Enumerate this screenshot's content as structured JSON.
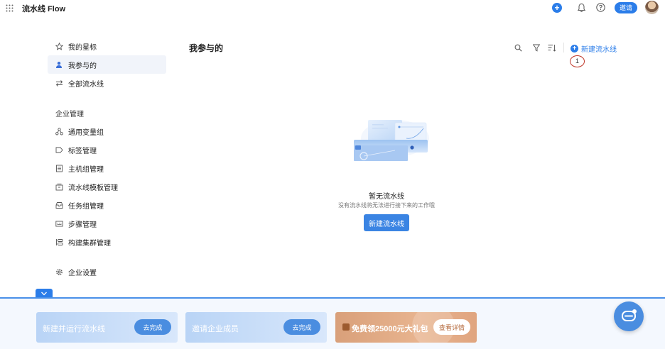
{
  "header": {
    "app_title": "流水线 Flow",
    "invite_label": "邀请"
  },
  "sidebar": {
    "top_items": [
      {
        "label": "我的星标",
        "icon": "star-icon"
      },
      {
        "label": "我参与的",
        "icon": "user-icon",
        "active": true
      },
      {
        "label": "全部流水线",
        "icon": "swap-icon"
      }
    ],
    "section_title": "企业管理",
    "manage_items": [
      {
        "label": "通用变量组",
        "icon": "variable-icon"
      },
      {
        "label": "标签管理",
        "icon": "tag-icon"
      },
      {
        "label": "主机组管理",
        "icon": "host-icon"
      },
      {
        "label": "流水线模板管理",
        "icon": "template-icon"
      },
      {
        "label": "任务组管理",
        "icon": "task-group-icon"
      },
      {
        "label": "步骤管理",
        "icon": "step-icon"
      },
      {
        "label": "构建集群管理",
        "icon": "cluster-icon"
      }
    ],
    "settings_label": "企业设置"
  },
  "main": {
    "title": "我参与的",
    "new_pipeline_label": "新建流水线",
    "step_marker": "1",
    "empty": {
      "title": "暂无流水线",
      "description": "没有流水线将无法进行接下来的工作哦",
      "button_label": "新建流水线"
    }
  },
  "bottom_bar": {
    "cards": [
      {
        "label": "新建并运行流水线",
        "button": "去完成"
      },
      {
        "label": "邀请企业成员",
        "button": "去完成"
      },
      {
        "label": "免费领25000元大礼包",
        "button": "查看详情"
      }
    ]
  },
  "colors": {
    "accent": "#2b7de9",
    "promo": "#d9a07a"
  }
}
